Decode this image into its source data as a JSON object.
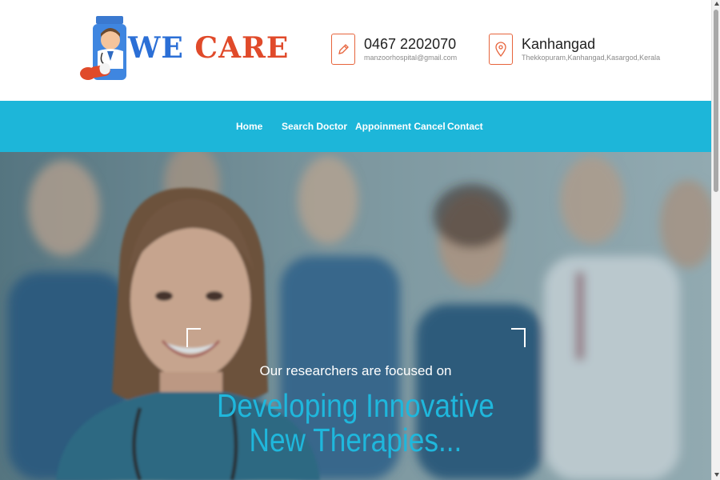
{
  "brand": {
    "logo_we": "WE",
    "logo_care": "CARE",
    "colors": {
      "we": "#2b6fd6",
      "care": "#e04a2a"
    }
  },
  "contact": {
    "phone": "0467 2202070",
    "email": "manzoorhospital@gmail.com",
    "location": "Kanhangad",
    "address": "Thekkopuram,Kanhangad,Kasargod,Kerala",
    "phone_icon": "pencil-icon",
    "location_icon": "map-pin-icon"
  },
  "nav": {
    "items": [
      {
        "label": "Home"
      },
      {
        "label": "Search Doctor"
      },
      {
        "label": "Appoinment Cancel"
      },
      {
        "label": "Contact"
      }
    ],
    "color": "#1db6d9"
  },
  "hero": {
    "subtitle": "Our researchers are focused on",
    "title_line1": "Developing Innovative",
    "title_line2": "New Therapies...",
    "title_color": "#1fb7dc"
  }
}
